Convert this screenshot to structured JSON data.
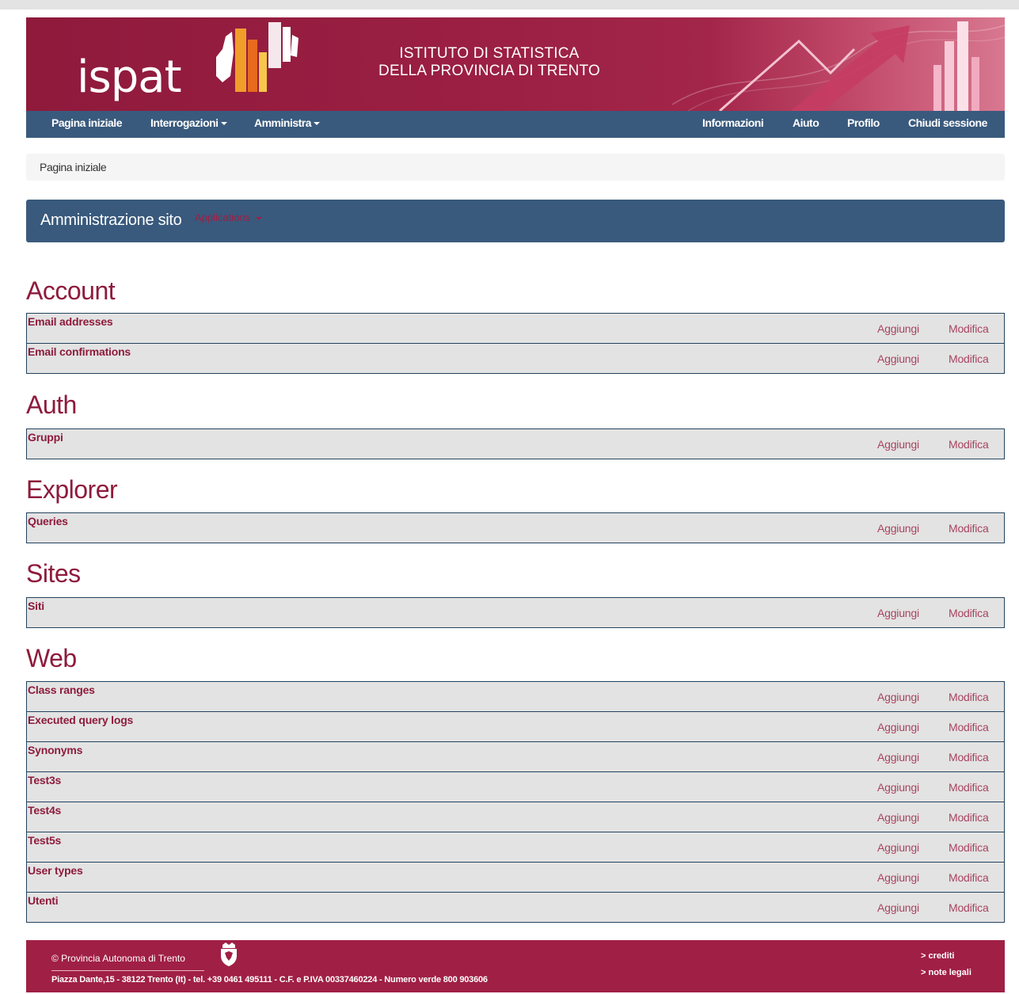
{
  "header": {
    "logo": "ispat",
    "institute_line1": "ISTITUTO DI STATISTICA",
    "institute_line2": "DELLA PROVINCIA DI TRENTO"
  },
  "nav": {
    "home": "Pagina iniziale",
    "queries": "Interrogazioni",
    "admin": "Amministra",
    "info": "Informazioni",
    "help": "Aiuto",
    "profile": "Profilo",
    "logout": "Chiudi sessione"
  },
  "breadcrumb": "Pagina iniziale",
  "admin": {
    "title": "Amministrazione sito",
    "apps_label": "Applications"
  },
  "actions": {
    "add": "Aggiungi",
    "edit": "Modifica"
  },
  "sections": [
    {
      "title": "Account",
      "models": [
        "Email addresses",
        "Email confirmations"
      ]
    },
    {
      "title": "Auth",
      "models": [
        "Gruppi"
      ]
    },
    {
      "title": "Explorer",
      "models": [
        "Queries"
      ]
    },
    {
      "title": "Sites",
      "models": [
        "Siti"
      ]
    },
    {
      "title": "Web",
      "models": [
        "Class ranges",
        "Executed query logs",
        "Synonyms",
        "Test3s",
        "Test4s",
        "Test5s",
        "User types",
        "Utenti"
      ]
    }
  ],
  "footer": {
    "copyright": "© Provincia Autonoma di Trento",
    "address": "Piazza Dante,15 - 38122 Trento (It) - tel. +39 0461 495111 - C.F. e P.IVA 00337460224 - Numero verde 800 903606",
    "credits": "> crediti",
    "legal": "> note legali"
  },
  "colors": {
    "banner": "#9a1f43",
    "navbar": "#395a7d",
    "accent": "#8e1b3c",
    "row_bg": "#e3e3e3"
  }
}
